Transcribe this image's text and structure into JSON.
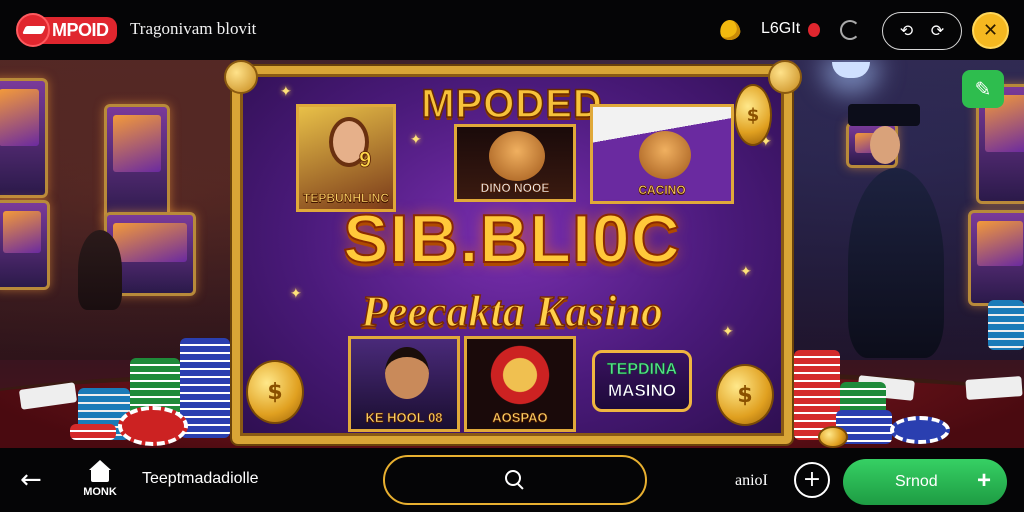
{
  "header": {
    "logo_text": "MPOID",
    "site_title": "Tragonivam blovit",
    "login_label": "L6GIt"
  },
  "hero": {
    "title_top": "MPODED",
    "title_main": "SIB.BLI0C",
    "title_sub": "Peecakta Kasino",
    "tiles": [
      {
        "label": "TEPBUNHLINC",
        "name": "tile-woman"
      },
      {
        "label": "DINO NOOE",
        "name": "tile-lion"
      },
      {
        "label": "CACINO",
        "name": "tile-cards-lion"
      },
      {
        "label": "KE HOOL 08",
        "name": "tile-man"
      },
      {
        "label": "AOSPAO",
        "name": "tile-roulette"
      }
    ],
    "badge": {
      "line1": "TEPDINA",
      "line2": "MASINO"
    },
    "tile_woman_number": "9"
  },
  "footer": {
    "home_label": "MONK",
    "title": "Teeptmadadiolle",
    "small_label": "anioI",
    "cta_label": "Srnod"
  },
  "colors": {
    "accent_gold": "#e8b030",
    "brand_red": "#e0262e",
    "cta_green": "#2ebd4e"
  }
}
